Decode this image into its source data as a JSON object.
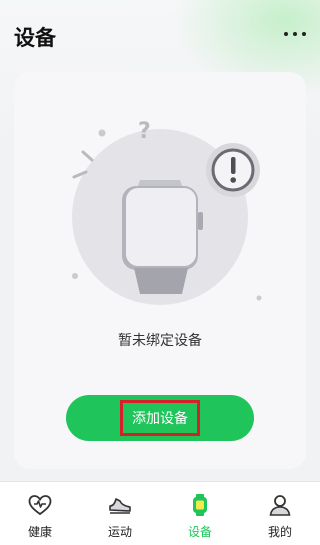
{
  "header": {
    "title": "设备",
    "more_icon": "more-dots-icon"
  },
  "empty_state": {
    "message": "暂未绑定设备",
    "illustration_icon": "smartwatch-alert-icon"
  },
  "add_button": {
    "label": "添加设备"
  },
  "tabbar": {
    "active": "设备",
    "accent_color": "#1fc45a",
    "tabs": [
      {
        "label": "健康",
        "icon": "heart-pulse-icon"
      },
      {
        "label": "运动",
        "icon": "running-shoe-icon"
      },
      {
        "label": "设备",
        "icon": "watch-icon"
      },
      {
        "label": "我的",
        "icon": "user-icon"
      }
    ]
  }
}
